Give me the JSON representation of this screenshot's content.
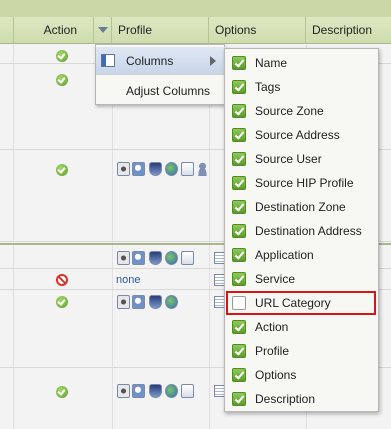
{
  "columns": {
    "action": "Action",
    "profile": "Profile",
    "options": "Options",
    "description": "Description"
  },
  "rows": {
    "none_label": "none"
  },
  "context_menu": {
    "columns_label": "Columns",
    "adjust_label": "Adjust Columns"
  },
  "submenu": {
    "items": [
      {
        "label": "Name",
        "checked": true
      },
      {
        "label": "Tags",
        "checked": true
      },
      {
        "label": "Source Zone",
        "checked": true
      },
      {
        "label": "Source Address",
        "checked": true
      },
      {
        "label": "Source User",
        "checked": true
      },
      {
        "label": "Source HIP Profile",
        "checked": true
      },
      {
        "label": "Destination Zone",
        "checked": true
      },
      {
        "label": "Destination Address",
        "checked": true
      },
      {
        "label": "Application",
        "checked": true
      },
      {
        "label": "Service",
        "checked": true
      },
      {
        "label": "URL Category",
        "checked": false
      },
      {
        "label": "Action",
        "checked": true
      },
      {
        "label": "Profile",
        "checked": true
      },
      {
        "label": "Options",
        "checked": true
      },
      {
        "label": "Description",
        "checked": true
      }
    ]
  },
  "colors": {
    "header_green": "#cedcae",
    "highlight_red": "#d7141a",
    "link_blue": "#2b5c9c"
  }
}
